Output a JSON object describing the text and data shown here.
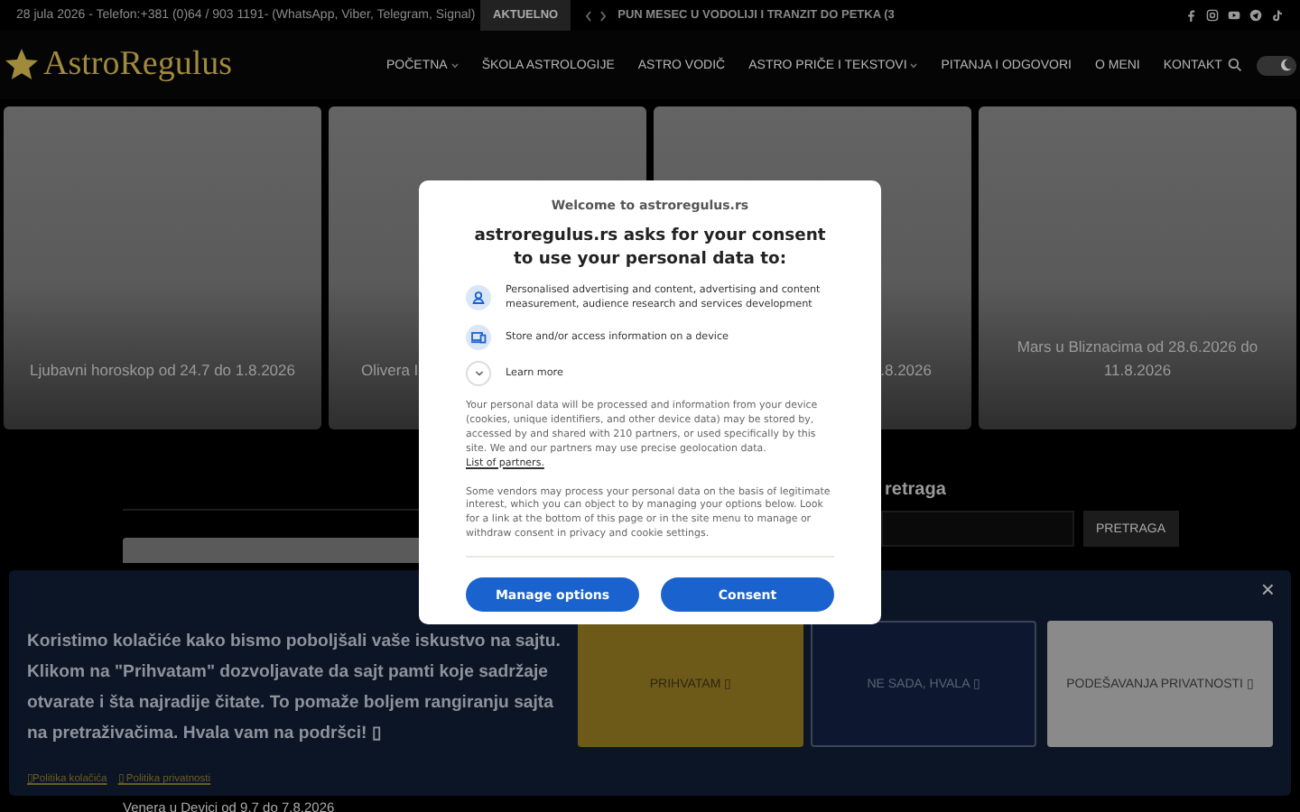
{
  "top_bar": {
    "info": "28 jula 2026 - Telefon:+381 (0)64 / 903 1191- (WhatsApp, Viber, Telegram, Signal)",
    "ticker_label": "AKTUELNO",
    "ticker_text": "PUN MESEC U VODOLIJI I TRANZIT DO PETKA (3"
  },
  "logo": "AstroRegulus",
  "nav": [
    {
      "label": "POČETNA",
      "dropdown": true
    },
    {
      "label": "ŠKOLA ASTROLOGIJE",
      "dropdown": false
    },
    {
      "label": "ASTRO VODIČ",
      "dropdown": false
    },
    {
      "label": "ASTRO PRIČE I TEKSTOVI",
      "dropdown": true
    },
    {
      "label": "PITANJA I ODGOVORI",
      "dropdown": false
    },
    {
      "label": "O MENI",
      "dropdown": false
    },
    {
      "label": "KONTAKT",
      "dropdown": false
    }
  ],
  "dark_mode": true,
  "cards": [
    {
      "title": "Ljubavni horoskop od 24.7 do 1.8.2026"
    },
    {
      "title": "Olivera I"
    },
    {
      "title": ".8.2026"
    },
    {
      "title": "Mars u Bliznacima od 28.6.2026 do 11.8.2026"
    }
  ],
  "search": {
    "heading": "retraga",
    "button": "PRETRAGA"
  },
  "post_title": "Venera u Devici od 9.7 do 7.8.2026",
  "consent": {
    "site": "Welcome to astroregulus.rs",
    "heading": "astroregulus.rs asks for your consent to use your personal data to:",
    "purposes": [
      {
        "kind": "person",
        "text": "Personalised advertising and content, advertising and content measurement, audience research and services development"
      },
      {
        "kind": "device",
        "text": "Store and/or access information on a device"
      }
    ],
    "learn_more": "Learn more",
    "paragraph_1": "Your personal data will be processed and information from your device (cookies, unique identifiers, and other device data) may be stored by, accessed by and shared with 210 partners, or used specifically by this site. We and our partners may use precise geolocation data.",
    "partners_link": "List of partners.",
    "paragraph_2": "Some vendors may process your personal data on the basis of legitimate interest, which you can object to by managing your options below. Look for a link at the bottom of this page or in the site menu to manage or withdraw consent in privacy and cookie settings.",
    "buttons": [
      "Manage options",
      "Consent"
    ]
  },
  "cookie_banner": {
    "text": "Koristimo kolačiće kako bismo poboljšali vaše iskustvo na sajtu. Klikom na \"Prihvatam\" dozvoljavate da sajt pamti koje sadržaje otvarate i šta najradije čitate. To pomaže boljem rangiranju sajta na pretraživačima. Hvala vam na podršci! ▯",
    "links": [
      "▯Politika kolačića",
      "▯ Politika privatnosti"
    ],
    "close": "×",
    "buttons": [
      {
        "label": "PRIHVATAM ▯",
        "kind": "accept"
      },
      {
        "label": "NE SADA, HVALA ▯",
        "kind": "decline"
      },
      {
        "label": "PODEŠAVANJA PRIVATNOSTI ▯",
        "kind": "settings"
      }
    ]
  }
}
